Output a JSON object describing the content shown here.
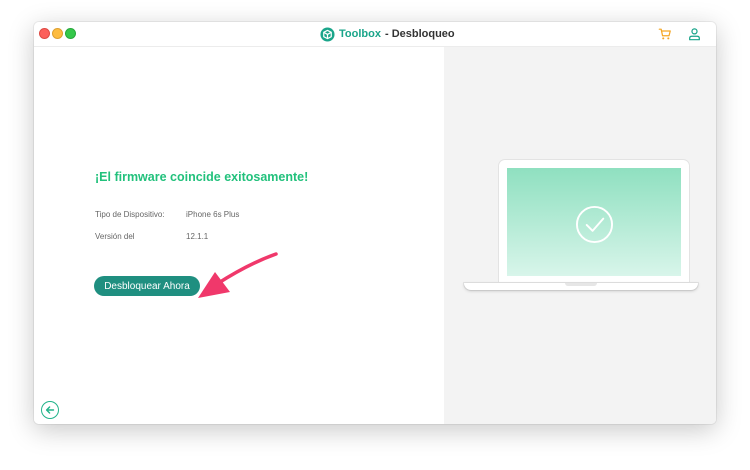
{
  "window": {
    "brand": "Toolbox",
    "title_suffix": "- Desbloqueo",
    "icons": [
      "close-button",
      "minimize-button",
      "zoom-button",
      "toolbox-logo-icon",
      "cart-icon",
      "user-icon"
    ]
  },
  "main": {
    "success_message": "¡El firmware coincide exitosamente!",
    "device_info": [
      {
        "label": "Tipo de Dispositivo:",
        "value": "iPhone 6s Plus"
      },
      {
        "label": "Versión del",
        "value": "12.1.1"
      }
    ],
    "unlock_button_label": "Desbloquear Ahora",
    "back_icon": "arrow-left-circle-icon"
  },
  "illustration": {
    "name": "laptop-success",
    "icon": "check-circle-icon"
  },
  "colors": {
    "accent": "#1aa58a",
    "success_text": "#22c17c",
    "button": "#1f8f80",
    "cart_orange": "#f5a623",
    "annotation_arrow": "#f0386b",
    "right_pane": "#f3f3f3"
  }
}
